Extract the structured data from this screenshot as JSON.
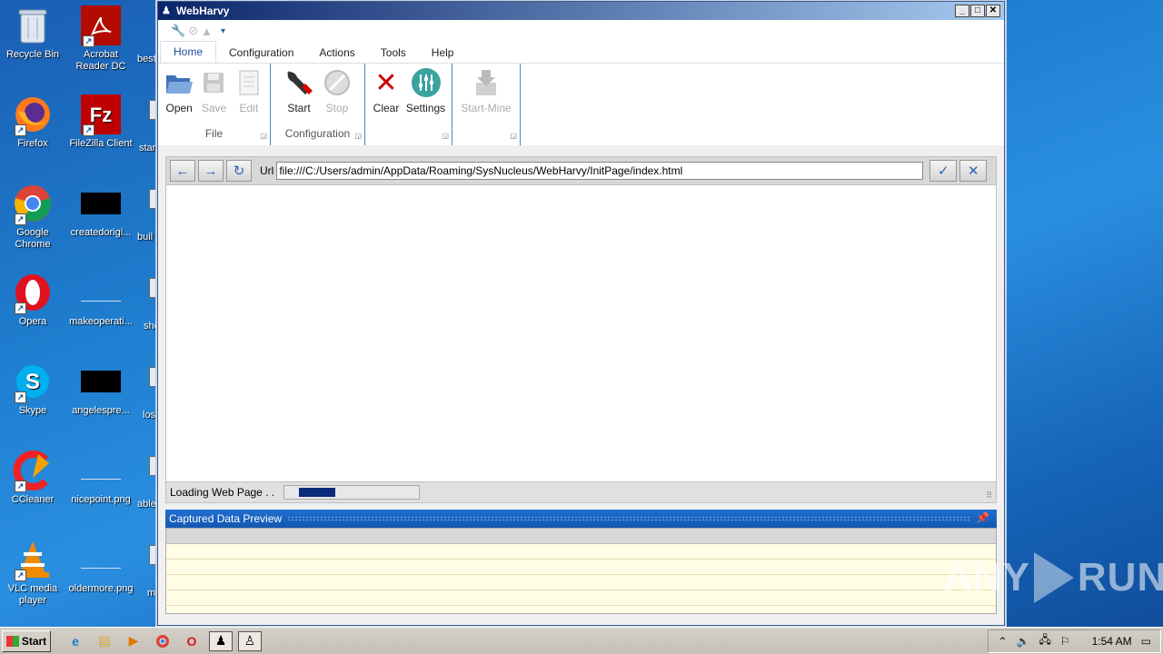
{
  "desktop": {
    "icons": [
      {
        "label": "Recycle Bin"
      },
      {
        "label": "Acrobat Reader DC"
      },
      {
        "label": "Firefox"
      },
      {
        "label": "FileZilla Client"
      },
      {
        "label": "Google Chrome"
      },
      {
        "label": "createdorigi..."
      },
      {
        "label": "Opera"
      },
      {
        "label": "makeoperati..."
      },
      {
        "label": "Skype"
      },
      {
        "label": "angelespre..."
      },
      {
        "label": "CCleaner"
      },
      {
        "label": "nicepoint.png"
      },
      {
        "label": "VLC media player"
      },
      {
        "label": "oldermore.png"
      }
    ],
    "partial_labels": [
      "best",
      "star",
      "buil",
      "sho",
      "los",
      "able",
      "mi"
    ]
  },
  "window": {
    "title": "WebHarvy",
    "qat_dropdown": "▾",
    "tabs": [
      {
        "label": "Home"
      },
      {
        "label": "Configuration"
      },
      {
        "label": "Actions"
      },
      {
        "label": "Tools"
      },
      {
        "label": "Help"
      }
    ],
    "ribbon": {
      "file": {
        "label": "File",
        "buttons": [
          {
            "label": "Open"
          },
          {
            "label": "Save"
          },
          {
            "label": "Edit"
          }
        ]
      },
      "configuration": {
        "label": "Configuration",
        "buttons": [
          {
            "label": "Start"
          },
          {
            "label": "Stop"
          }
        ]
      },
      "actions": {
        "buttons": [
          {
            "label": "Clear"
          },
          {
            "label": "Settings"
          }
        ]
      },
      "mine": {
        "buttons": [
          {
            "label": "Start-Mine"
          }
        ]
      }
    },
    "url_label": "Url",
    "url_value": "file:///C:/Users/admin/AppData/Roaming/SysNucleus/WebHarvy/InitPage/index.html",
    "status_text": "Loading Web Page . .",
    "progress_fraction": 0.27,
    "panel_title": "Captured Data Preview"
  },
  "watermark": {
    "left": "ANY",
    "right": "RUN"
  },
  "taskbar": {
    "start_label": "Start",
    "clock": "1:54 AM"
  },
  "colors": {
    "accent": "#1f6fd0",
    "progress_fill": "#0a2a7a",
    "preview_grid": "#fffde6"
  }
}
